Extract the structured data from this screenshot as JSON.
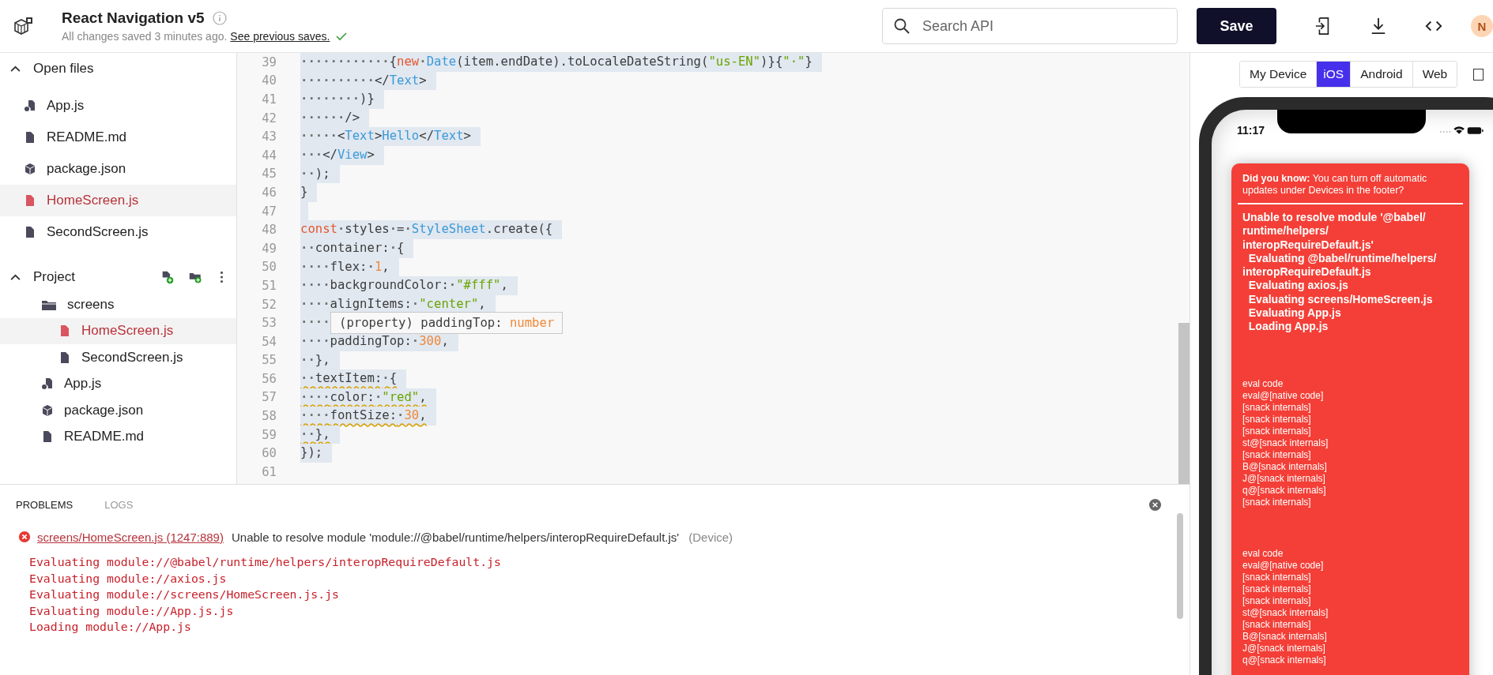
{
  "header": {
    "title": "React Navigation v5",
    "status": "All changes saved 3 minutes ago.",
    "link": "See previous saves.",
    "search": {
      "placeholder": "Search API"
    },
    "save": "Save",
    "avatar": "N"
  },
  "sidebar": {
    "sections": [
      {
        "title": "Open files",
        "expanded": true,
        "tools": false,
        "items": [
          {
            "name": "App.js",
            "kind": "app",
            "selected": false
          },
          {
            "name": "README.md",
            "kind": "file",
            "selected": false
          },
          {
            "name": "package.json",
            "kind": "package",
            "selected": false
          },
          {
            "name": "HomeScreen.js",
            "kind": "file",
            "selected": true
          },
          {
            "name": "SecondScreen.js",
            "kind": "file",
            "selected": false
          }
        ]
      },
      {
        "title": "Project",
        "expanded": true,
        "tools": true,
        "items": [
          {
            "name": "screens",
            "kind": "folder",
            "selected": false,
            "children": [
              {
                "name": "HomeScreen.js",
                "kind": "file",
                "selected": true
              },
              {
                "name": "SecondScreen.js",
                "kind": "file",
                "selected": false
              }
            ]
          },
          {
            "name": "App.js",
            "kind": "app",
            "selected": false
          },
          {
            "name": "package.json",
            "kind": "package",
            "selected": false
          },
          {
            "name": "README.md",
            "kind": "file",
            "selected": false
          }
        ]
      }
    ]
  },
  "editor": {
    "lines": [
      {
        "n": "39",
        "selected": true,
        "warn": false,
        "tokens": [
          {
            "kind": "space",
            "text": "············"
          },
          {
            "kind": "plain",
            "text": "{"
          },
          {
            "kind": "keyword",
            "text": "new"
          },
          {
            "kind": "space",
            "text": "·"
          },
          {
            "kind": "type",
            "text": "Date"
          },
          {
            "kind": "plain",
            "text": "(item.endDate).toLocaleDateString("
          },
          {
            "kind": "string",
            "text": "\"us-EN\""
          },
          {
            "kind": "plain",
            "text": ")}{"
          },
          {
            "kind": "string",
            "text": "\"·\""
          },
          {
            "kind": "plain",
            "text": "}"
          }
        ]
      },
      {
        "n": "40",
        "selected": true,
        "warn": false,
        "tokens": [
          {
            "kind": "space",
            "text": "··········"
          },
          {
            "kind": "plain",
            "text": "</"
          },
          {
            "kind": "type",
            "text": "Text"
          },
          {
            "kind": "plain",
            "text": ">"
          }
        ]
      },
      {
        "n": "41",
        "selected": true,
        "warn": false,
        "tokens": [
          {
            "kind": "space",
            "text": "········"
          },
          {
            "kind": "plain",
            "text": ")}"
          }
        ]
      },
      {
        "n": "42",
        "selected": true,
        "warn": false,
        "tokens": [
          {
            "kind": "space",
            "text": "······"
          },
          {
            "kind": "plain",
            "text": "/>"
          }
        ]
      },
      {
        "n": "43",
        "selected": true,
        "warn": false,
        "tokens": [
          {
            "kind": "space",
            "text": "·····"
          },
          {
            "kind": "plain",
            "text": "<"
          },
          {
            "kind": "type",
            "text": "Text"
          },
          {
            "kind": "plain",
            "text": ">"
          },
          {
            "kind": "type",
            "text": "Hello"
          },
          {
            "kind": "plain",
            "text": "</"
          },
          {
            "kind": "type",
            "text": "Text"
          },
          {
            "kind": "plain",
            "text": ">"
          }
        ]
      },
      {
        "n": "44",
        "selected": true,
        "warn": false,
        "tokens": [
          {
            "kind": "space",
            "text": "···"
          },
          {
            "kind": "plain",
            "text": "</"
          },
          {
            "kind": "type",
            "text": "View"
          },
          {
            "kind": "plain",
            "text": ">"
          }
        ]
      },
      {
        "n": "45",
        "selected": true,
        "warn": false,
        "tokens": [
          {
            "kind": "space",
            "text": "··"
          },
          {
            "kind": "plain",
            "text": ");"
          }
        ]
      },
      {
        "n": "46",
        "selected": true,
        "warn": false,
        "tokens": [
          {
            "kind": "plain",
            "text": "}"
          }
        ]
      },
      {
        "n": "47",
        "selected": true
      },
      {
        "n": "48",
        "selected": true,
        "warn": false,
        "tokens": [
          {
            "kind": "keyword",
            "text": "const"
          },
          {
            "kind": "space",
            "text": "·"
          },
          {
            "kind": "plain",
            "text": "styles"
          },
          {
            "kind": "space",
            "text": "·"
          },
          {
            "kind": "plain",
            "text": "="
          },
          {
            "kind": "space",
            "text": "·"
          },
          {
            "kind": "type",
            "text": "StyleSheet"
          },
          {
            "kind": "plain",
            "text": ".create({"
          }
        ]
      },
      {
        "n": "49",
        "selected": true,
        "warn": false,
        "tokens": [
          {
            "kind": "space",
            "text": "··"
          },
          {
            "kind": "plain",
            "text": "container:"
          },
          {
            "kind": "space",
            "text": "·"
          },
          {
            "kind": "plain",
            "text": "{"
          }
        ]
      },
      {
        "n": "50",
        "selected": true,
        "warn": false,
        "tokens": [
          {
            "kind": "space",
            "text": "····"
          },
          {
            "kind": "plain",
            "text": "flex:"
          },
          {
            "kind": "space",
            "text": "·"
          },
          {
            "kind": "number",
            "text": "1"
          },
          {
            "kind": "plain",
            "text": ","
          }
        ]
      },
      {
        "n": "51",
        "selected": true,
        "warn": false,
        "tokens": [
          {
            "kind": "space",
            "text": "····"
          },
          {
            "kind": "plain",
            "text": "backgroundColor:"
          },
          {
            "kind": "space",
            "text": "·"
          },
          {
            "kind": "string",
            "text": "\"#fff\""
          },
          {
            "kind": "plain",
            "text": ","
          }
        ]
      },
      {
        "n": "52",
        "selected": true,
        "warn": false,
        "tokens": [
          {
            "kind": "space",
            "text": "····"
          },
          {
            "kind": "plain",
            "text": "alignItems:"
          },
          {
            "kind": "space",
            "text": "·"
          },
          {
            "kind": "string",
            "text": "\"center\""
          },
          {
            "kind": "plain",
            "text": ","
          }
        ]
      },
      {
        "n": "53",
        "selected": true,
        "warn": false,
        "tokens": [
          {
            "kind": "space",
            "text": "····"
          }
        ],
        "tooltip": [
          {
            "kind": "plain",
            "text": "(property) paddingTop: "
          },
          {
            "kind": "number",
            "text": "number"
          }
        ]
      },
      {
        "n": "54",
        "selected": true,
        "warn": false,
        "tokens": [
          {
            "kind": "space",
            "text": "····"
          },
          {
            "kind": "plain",
            "text": "paddingTop:"
          },
          {
            "kind": "space",
            "text": "·"
          },
          {
            "kind": "number",
            "text": "300"
          },
          {
            "kind": "plain",
            "text": ","
          }
        ]
      },
      {
        "n": "55",
        "selected": true,
        "warn": false,
        "tokens": [
          {
            "kind": "space",
            "text": "··"
          },
          {
            "kind": "plain",
            "text": "},"
          }
        ]
      },
      {
        "n": "56",
        "selected": true,
        "warn": true,
        "tokens": [
          {
            "kind": "space",
            "text": "··"
          },
          {
            "kind": "plain",
            "text": "textItem:"
          },
          {
            "kind": "space",
            "text": "·"
          },
          {
            "kind": "plain",
            "text": "{"
          }
        ]
      },
      {
        "n": "57",
        "selected": true,
        "warn": true,
        "tokens": [
          {
            "kind": "space",
            "text": "····"
          },
          {
            "kind": "plain",
            "text": "color:"
          },
          {
            "kind": "space",
            "text": "·"
          },
          {
            "kind": "string",
            "text": "\"red\""
          },
          {
            "kind": "plain",
            "text": ","
          }
        ]
      },
      {
        "n": "58",
        "selected": true,
        "warn": true,
        "tokens": [
          {
            "kind": "space",
            "text": "····"
          },
          {
            "kind": "plain",
            "text": "fontSize:"
          },
          {
            "kind": "space",
            "text": "·"
          },
          {
            "kind": "number",
            "text": "30"
          },
          {
            "kind": "plain",
            "text": ","
          }
        ]
      },
      {
        "n": "59",
        "selected": true,
        "warn": true,
        "tokens": [
          {
            "kind": "space",
            "text": "··"
          },
          {
            "kind": "plain",
            "text": "},"
          }
        ]
      },
      {
        "n": "60",
        "selected": true,
        "warn": false,
        "tokens": [
          {
            "kind": "plain",
            "text": "});"
          }
        ]
      },
      {
        "n": "61",
        "selected": false
      }
    ]
  },
  "problems": {
    "tabs": [
      {
        "label": "PROBLEMS",
        "selected": true
      },
      {
        "label": "LOGS",
        "selected": false
      }
    ],
    "error": {
      "location": "screens/HomeScreen.js (1247:889)",
      "message": "Unable to resolve module 'module://@babel/runtime/helpers/interopRequireDefault.js'",
      "source": "(Device)",
      "trace": [
        "Evaluating module://@babel/runtime/helpers/interopRequireDefault.js",
        "Evaluating module://axios.js",
        "Evaluating module://screens/HomeScreen.js.js",
        "Evaluating module://App.js.js",
        "Loading module://App.js"
      ]
    }
  },
  "preview": {
    "tabs": [
      {
        "label": "My Device",
        "selected": false
      },
      {
        "label": "iOS",
        "selected": true
      },
      {
        "label": "Android",
        "selected": false
      },
      {
        "label": "Web",
        "selected": false
      }
    ],
    "phone": {
      "time": "11:17",
      "tip": "**Did you know:** You can turn off automatic updates under Devices in the footer?",
      "error_lines": [
        "Unable to resolve module '@babel/",
        "runtime/helpers/",
        "interopRequireDefault.js'",
        "  Evaluating @babel/runtime/helpers/",
        "interopRequireDefault.js",
        "  Evaluating axios.js",
        "  Evaluating screens/HomeScreen.js",
        "  Evaluating App.js",
        "  Loading App.js"
      ],
      "stack_blocks": [
        [
          "eval code",
          "eval@[native code]",
          "[snack internals]",
          "[snack internals]",
          "[snack internals]",
          "st@[snack internals]",
          "[snack internals]",
          "B@[snack internals]",
          "J@[snack internals]",
          "q@[snack internals]",
          "[snack internals]"
        ],
        [
          "eval code",
          "eval@[native code]",
          "[snack internals]",
          "[snack internals]",
          "[snack internals]",
          "st@[snack internals]",
          "[snack internals]",
          "B@[snack internals]",
          "J@[snack internals]",
          "q@[snack internals]"
        ]
      ]
    }
  }
}
